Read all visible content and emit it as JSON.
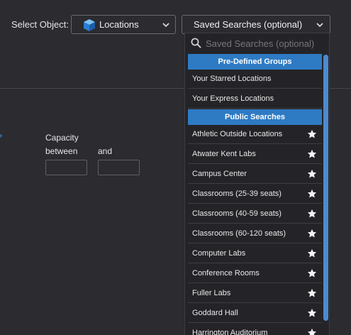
{
  "header": {
    "select_object_label": "Select Object:",
    "object_select": {
      "value": "Locations",
      "icon": "cube-icon"
    },
    "saved_searches_select": {
      "value": "Saved Searches (optional)"
    }
  },
  "capacity": {
    "label": "Capacity",
    "between_label": "between",
    "and_label": "and",
    "min_value": "",
    "max_value": ""
  },
  "dropdown": {
    "search_placeholder": "Saved Searches (optional)",
    "groups": [
      {
        "header": "Pre-Defined Groups",
        "items": [
          {
            "label": "Your Starred Locations"
          },
          {
            "label": "Your Express Locations"
          }
        ]
      },
      {
        "header": "Public Searches",
        "items": [
          {
            "label": "Athletic Outside Locations"
          },
          {
            "label": "Atwater Kent Labs"
          },
          {
            "label": "Campus Center"
          },
          {
            "label": "Classrooms (25-39 seats)"
          },
          {
            "label": "Classrooms (40-59 seats)"
          },
          {
            "label": "Classrooms (60-120 seats)"
          },
          {
            "label": "Computer Labs"
          },
          {
            "label": "Conference Rooms"
          },
          {
            "label": "Fuller Labs"
          },
          {
            "label": "Goddard Hall"
          },
          {
            "label": "Harrington Auditorium"
          }
        ]
      }
    ]
  },
  "colors": {
    "background": "#2b2b30",
    "accent": "#2e7bc4",
    "dropdown_bg": "#242428",
    "scroll_thumb": "#4d8ad0"
  }
}
